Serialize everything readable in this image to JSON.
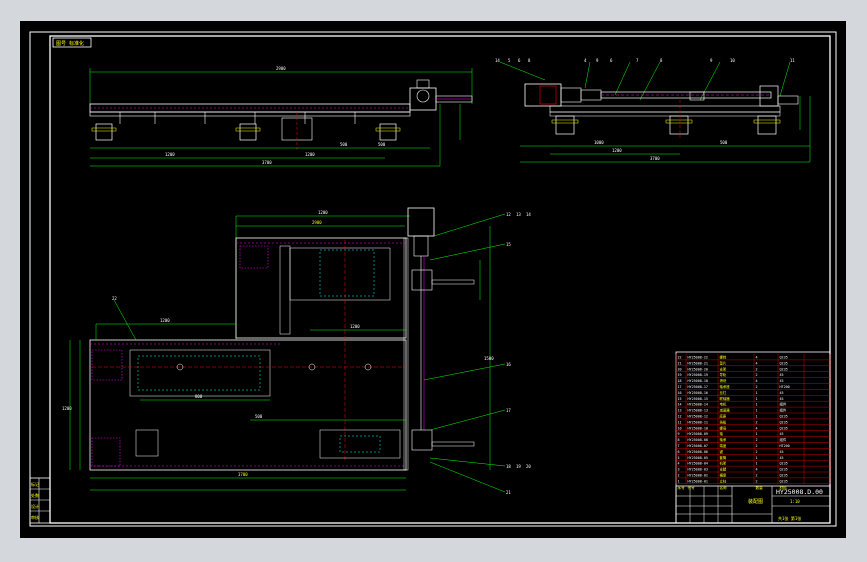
{
  "drawing": {
    "tag_label": "图号 标准化",
    "top_left_dims": [
      "2900",
      "1200",
      "1200",
      "500",
      "500",
      "500",
      "3700",
      "500",
      "1500"
    ],
    "top_right_callouts": [
      "14",
      "5",
      "6",
      "8",
      "4",
      "9",
      "6",
      "7",
      "8",
      "9",
      "10",
      "11"
    ],
    "top_right_dims": [
      "1000",
      "500",
      "800",
      "1200",
      "3700"
    ],
    "plan_callouts": [
      "12",
      "13",
      "14",
      "15",
      "16",
      "17",
      "18",
      "19",
      "20",
      "21",
      "22"
    ],
    "plan_dims": [
      "1200",
      "2900",
      "1200",
      "3700",
      "1500",
      "1200",
      "500",
      "1200",
      "800"
    ],
    "left_table_rows": [
      "标记",
      "处数",
      "设计",
      "审核"
    ]
  },
  "title_block": {
    "drawing_number": "HY25008.D.00",
    "title": "装配图",
    "scale": "1:10",
    "sheet": "共1张 第1张",
    "bom_rows": [
      [
        "22",
        "HY25008-22",
        "螺栓",
        "4",
        "Q235"
      ],
      [
        "21",
        "HY25008-21",
        "垫片",
        "4",
        "Q235"
      ],
      [
        "20",
        "HY25008-20",
        "支架",
        "2",
        "Q235"
      ],
      [
        "19",
        "HY25008-19",
        "导轨",
        "2",
        "45"
      ],
      [
        "18",
        "HY25008-18",
        "滑块",
        "4",
        "45"
      ],
      [
        "17",
        "HY25008-17",
        "轴承座",
        "2",
        "HT200"
      ],
      [
        "16",
        "HY25008-16",
        "丝杠",
        "1",
        "45"
      ],
      [
        "15",
        "HY25008-15",
        "联轴器",
        "1",
        "45"
      ],
      [
        "14",
        "HY25008-14",
        "电机",
        "1",
        "组件"
      ],
      [
        "13",
        "HY25008-13",
        "减速器",
        "1",
        "组件"
      ],
      [
        "12",
        "HY25008-12",
        "底座",
        "1",
        "Q235"
      ],
      [
        "11",
        "HY25008-11",
        "挡板",
        "2",
        "Q235"
      ],
      [
        "10",
        "HY25008-10",
        "螺母",
        "4",
        "Q235"
      ],
      [
        "9",
        "HY25008-09",
        "轴",
        "1",
        "45"
      ],
      [
        "8",
        "HY25008-08",
        "轴承",
        "2",
        "组件"
      ],
      [
        "7",
        "HY25008-07",
        "端盖",
        "2",
        "HT200"
      ],
      [
        "6",
        "HY25008-06",
        "键",
        "2",
        "45"
      ],
      [
        "5",
        "HY25008-05",
        "套筒",
        "1",
        "45"
      ],
      [
        "4",
        "HY25008-04",
        "机架",
        "1",
        "Q235"
      ],
      [
        "3",
        "HY25008-03",
        "支腿",
        "4",
        "Q235"
      ],
      [
        "2",
        "HY25008-02",
        "横梁",
        "2",
        "Q235"
      ],
      [
        "1",
        "HY25008-01",
        "立柱",
        "2",
        "Q235"
      ]
    ],
    "header": [
      "序号",
      "代号",
      "名称",
      "数量",
      "材料"
    ]
  }
}
